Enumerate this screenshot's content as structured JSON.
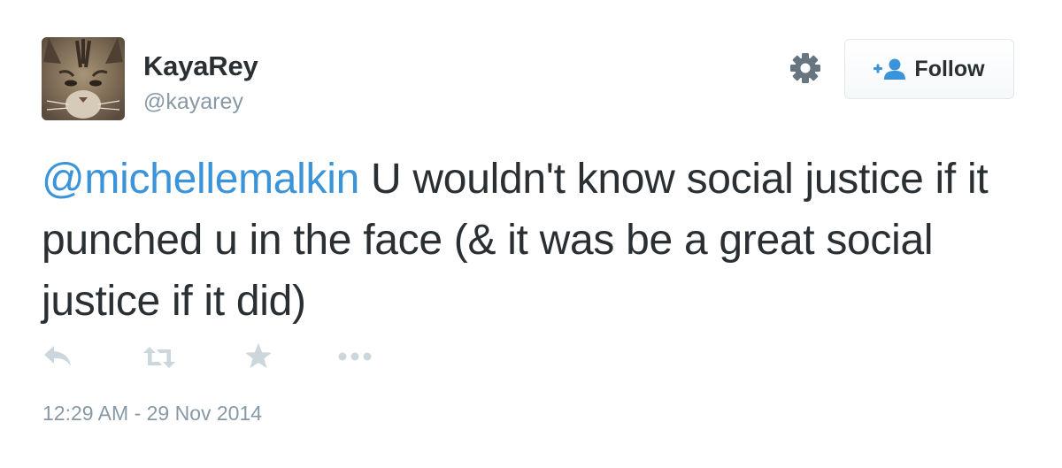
{
  "user": {
    "display_name": "KayaRey",
    "handle": "@kayarey",
    "avatar": "cat-photo"
  },
  "header": {
    "settings_icon": "gear-icon",
    "follow_icon": "add-user-icon",
    "follow_label": "Follow"
  },
  "tweet": {
    "mention": "@michellemalkin",
    "body": " U wouldn't know social justice if it punched u in the face (& it was be a great social justice if it did)",
    "timestamp": "12:29 AM - 29 Nov 2014"
  },
  "actions": {
    "reply_icon": "reply-icon",
    "retweet_icon": "retweet-icon",
    "favorite_icon": "star-icon",
    "more_icon": "more-dots-icon"
  },
  "colors": {
    "link": "#3b94d9",
    "text": "#292f33",
    "muted": "#8899a6",
    "icon": "#ccd6dd",
    "gear": "#66757f"
  }
}
